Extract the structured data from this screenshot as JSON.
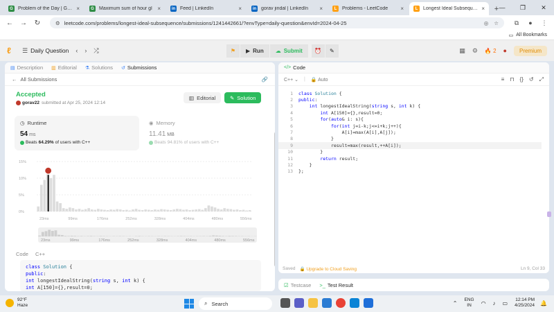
{
  "browser": {
    "tabs": [
      {
        "title": "Problem of the Day | Geeks",
        "color": "#2f8d46",
        "glyph": "G"
      },
      {
        "title": "Maximum sum of hour gl",
        "color": "#2f8d46",
        "glyph": "G"
      },
      {
        "title": "Feed | LinkedIn",
        "color": "#0a66c2",
        "glyph": "in"
      },
      {
        "title": "gorav jindal | LinkedIn",
        "color": "#0a66c2",
        "glyph": "in"
      },
      {
        "title": "Problems - LeetCode",
        "color": "#ffa116",
        "glyph": "L"
      },
      {
        "title": "Longest Ideal Subsequence",
        "color": "#ffa116",
        "glyph": "L"
      }
    ],
    "url": "leetcode.com/problems/longest-ideal-subsequence/submissions/1241442661/?envType=daily-question&envId=2024-04-25",
    "bookmarks_label": "All Bookmarks"
  },
  "nav": {
    "daily_question": "Daily Question",
    "run": "Run",
    "submit": "Submit",
    "streak": "2",
    "premium": "Premium"
  },
  "left": {
    "tabs": [
      "Description",
      "Editorial",
      "Solutions",
      "Submissions"
    ],
    "all_submissions": "All Submissions",
    "status": "Accepted",
    "user": "gorav22",
    "submitted_at": "submitted at Apr 25, 2024 12:14",
    "editorial_btn": "Editorial",
    "solution_btn": "Solution",
    "runtime": {
      "label": "Runtime",
      "value": "54",
      "unit": "ms",
      "beats_prefix": "Beats",
      "beats_pct": "64.29%",
      "beats_suffix": "of users with C++"
    },
    "memory": {
      "label": "Memory",
      "value": "11.41",
      "unit": "MB",
      "beats_prefix": "Beats",
      "beats_pct": "94.81%",
      "beats_suffix": "of users with C++"
    },
    "code_label": "Code",
    "code_lang": "C++",
    "code_preview": [
      "class Solution {",
      "public:",
      "    int longestIdealString(string s, int k) {",
      "        int A[150]={},result=0;"
    ]
  },
  "chart_data": {
    "type": "bar",
    "ylabel_ticks": [
      "15%",
      "10%",
      "5%",
      "0%"
    ],
    "ylim": [
      0,
      15
    ],
    "x_ticks": [
      "23ms",
      "99ms",
      "176ms",
      "252ms",
      "328ms",
      "404ms",
      "480ms",
      "556ms"
    ],
    "x_range": [
      23,
      600
    ],
    "highlight": {
      "x": 54,
      "value": 11
    },
    "values": [
      1.5,
      8,
      9.5,
      12,
      10,
      11,
      3,
      2.5,
      1,
      0.8,
      1.2,
      1,
      0.6,
      0.8,
      0.5,
      0.7,
      1,
      0.6,
      0.5,
      0.8,
      0.6,
      0.5,
      0.4,
      0.6,
      0.5,
      0.7,
      0.6,
      0.4,
      0.5,
      0.3,
      0.6,
      0.8,
      0.5,
      0.4,
      0.6,
      0.5,
      0.4,
      0.6,
      0.5,
      0.7,
      0.6,
      0.5,
      0.4,
      0.6,
      0.8,
      0.7,
      0.5,
      0.6,
      0.4,
      0.5,
      0.6,
      0.7,
      0.5,
      1,
      1.8,
      1.5,
      1.2,
      0.8,
      0.6,
      1,
      0.8,
      0.7,
      0.5,
      0.6,
      0.4,
      0.5,
      0.3,
      0.4
    ]
  },
  "right": {
    "code_tab": "Code",
    "lang": "C++",
    "mode": "Auto",
    "lines": [
      "class Solution {",
      "public:",
      "    int longestIdealString(string s, int k) {",
      "        int A[150]={},result=0;",
      "        for(auto& i: s){",
      "            for(int j=i-k;j<=i+k;j++){",
      "                A[i]=max(A[i],A[j]);",
      "            }",
      "            result=max(result,++A[i]);",
      "        }",
      "        return result;",
      "    }",
      "};"
    ],
    "current_line": 9,
    "saved": "Saved",
    "upgrade": "Upgrade to Cloud Saving",
    "cursor_pos": "Ln 9, Col 33",
    "testcase": "Testcase",
    "test_result": "Test Result"
  },
  "taskbar": {
    "temp": "92°F",
    "weather": "Haze",
    "search": "Search",
    "lang_top": "ENG",
    "lang_bottom": "IN",
    "time": "12:14 PM",
    "date": "4/25/2024"
  }
}
